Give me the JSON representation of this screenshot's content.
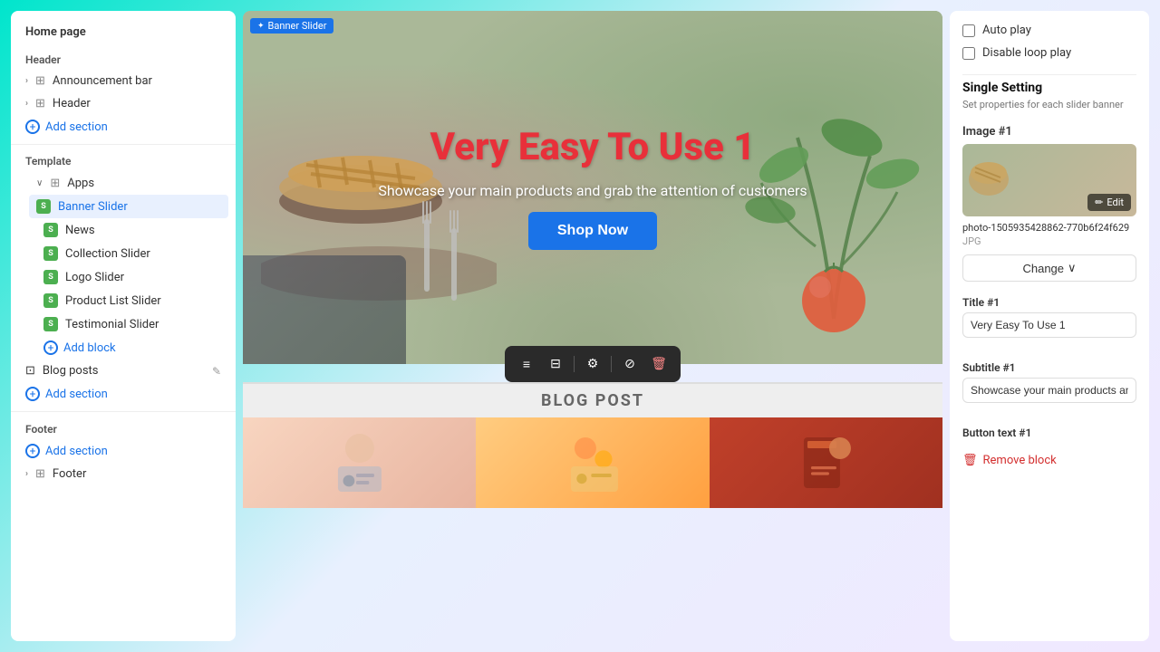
{
  "sidebar": {
    "page_title": "Home page",
    "header_section": "Header",
    "items": {
      "announcement_bar": "Announcement bar",
      "header": "Header",
      "template": "Template",
      "apps": "Apps",
      "banner_slider": "Banner Slider",
      "news": "News",
      "collection_slider": "Collection Slider",
      "logo_slider": "Logo Slider",
      "product_list_slider": "Product List Slider",
      "testimonial_slider": "Testimonial Slider",
      "blog_posts": "Blog posts",
      "footer": "Footer"
    },
    "add_section_labels": {
      "header_add": "Add section",
      "template_add": "Add section",
      "footer_add": "Add section"
    },
    "add_block": "Add block",
    "footer_section": "Footer"
  },
  "banner": {
    "label": "Banner Slider",
    "title": "Very Easy To Use 1",
    "subtitle": "Showcase your main products and grab the attention of customers",
    "cta": "Shop Now"
  },
  "blog_section": {
    "label": "BLOG POST"
  },
  "toolbar": {
    "buttons": [
      "align-left",
      "align-center",
      "settings",
      "block",
      "delete"
    ]
  },
  "right_panel": {
    "auto_play": "Auto play",
    "disable_loop": "Disable loop play",
    "single_setting_title": "Single Setting",
    "single_setting_sub": "Set properties for each slider banner",
    "image_label": "Image #1",
    "image_filename": "photo-1505935428862-770b6f24f629",
    "image_ext": "JPG",
    "change_btn": "Change",
    "edit_btn": "Edit",
    "title_label": "Title #1",
    "title_value": "Very Easy To Use 1",
    "subtitle_label": "Subtitle #1",
    "subtitle_value": "Showcase your main products and grab",
    "button_text_label": "Button text #1",
    "remove_block": "Remove block"
  }
}
